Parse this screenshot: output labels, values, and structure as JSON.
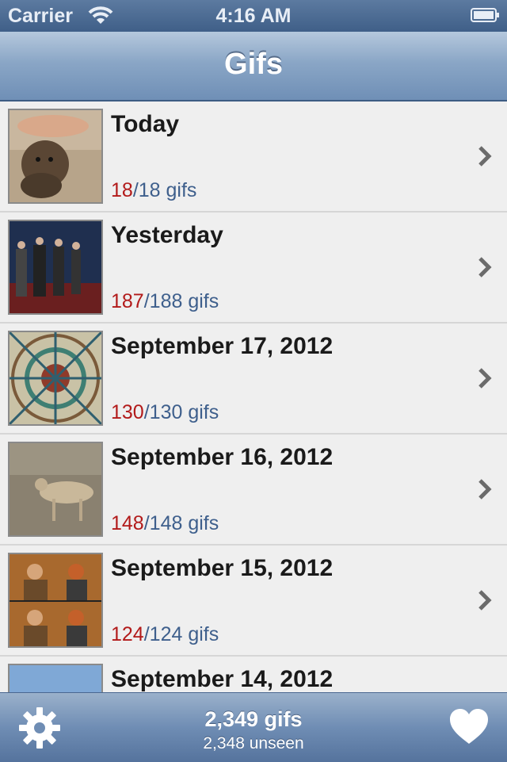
{
  "status_bar": {
    "carrier": "Carrier",
    "time": "4:16 AM"
  },
  "nav": {
    "title": "Gifs"
  },
  "rows": [
    {
      "title": "Today",
      "seen": "18",
      "total": "/18 gifs"
    },
    {
      "title": "Yesterday",
      "seen": "187",
      "total": "/188 gifs"
    },
    {
      "title": "September 17, 2012",
      "seen": "130",
      "total": "/130 gifs"
    },
    {
      "title": "September 16, 2012",
      "seen": "148",
      "total": "/148 gifs"
    },
    {
      "title": "September 15, 2012",
      "seen": "124",
      "total": "/124 gifs"
    },
    {
      "title": "September 14, 2012",
      "seen": "",
      "total": ""
    }
  ],
  "toolbar": {
    "total": "2,349 gifs",
    "unseen": "2,348 unseen"
  },
  "icons": {
    "settings": "gear-icon",
    "favorites": "heart-icon",
    "disclosure": "chevron-right-icon"
  }
}
